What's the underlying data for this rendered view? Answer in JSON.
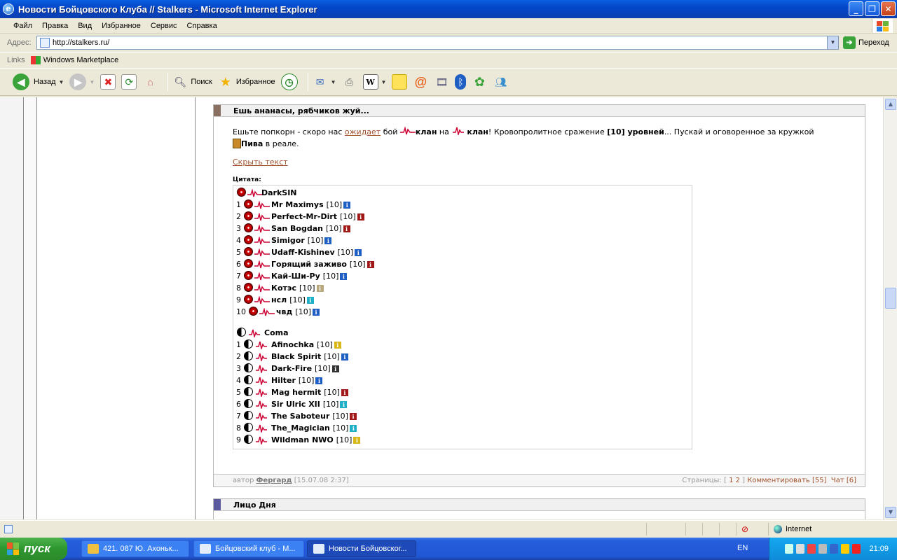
{
  "window": {
    "title": "Новости Бойцовского Клуба // Stalkers - Microsoft Internet Explorer"
  },
  "menu": [
    "Файл",
    "Правка",
    "Вид",
    "Избранное",
    "Сервис",
    "Справка"
  ],
  "address": {
    "label": "Адрес:",
    "url": "http://stalkers.ru/",
    "go": "Переход"
  },
  "links": {
    "label": "Links",
    "item": "Windows Marketplace"
  },
  "toolbar": {
    "back": "Назад",
    "search": "Поиск",
    "favorites": "Избранное"
  },
  "article": {
    "title": "Ешь ананасы, рябчиков жуй...",
    "text_1": "Ешьте попкорн - скоро нас ",
    "link_waits": "ожидает",
    "text_2": " бой ",
    "clan_word": "клан",
    "text_on": " на ",
    "text_3": "! Кровопролитное сражение ",
    "levels": "[10] уровней",
    "text_4": "... Пускай и оговоренное за кружкой ",
    "beer": "Пива",
    "text_5": " в реале.",
    "hide_link": "Скрыть текст",
    "quote_label": "Цитата:",
    "team1": {
      "name": "DarkSIN",
      "members": [
        {
          "n": "1",
          "name": "Mr Maximys",
          "lvl": "[10]",
          "info": "#1f5fc4"
        },
        {
          "n": "2",
          "name": "Perfect-Mr-Dirt",
          "lvl": "[10]",
          "info": "#a01818"
        },
        {
          "n": "3",
          "name": "San Bogdan",
          "lvl": "[10]",
          "info": "#a01818"
        },
        {
          "n": "4",
          "name": "Simigor",
          "lvl": "[10]",
          "info": "#1f5fc4"
        },
        {
          "n": "5",
          "name": "Udaff-Kishinev",
          "lvl": "[10]",
          "info": "#1f5fc4"
        },
        {
          "n": "6",
          "name": "Горящий заживо",
          "lvl": "[10]",
          "info": "#a01818"
        },
        {
          "n": "7",
          "name": "Кай-Ши-Ру",
          "lvl": "[10]",
          "info": "#1f5fc4"
        },
        {
          "n": "8",
          "name": "Котэс",
          "lvl": "[10]",
          "info": "#b8a77a"
        },
        {
          "n": "9",
          "name": "нсл",
          "lvl": "[10]",
          "info": "#1fb0c8"
        },
        {
          "n": "10",
          "name": "чвд",
          "lvl": "[10]",
          "info": "#1f5fc4"
        }
      ]
    },
    "team2": {
      "name": "Coma",
      "members": [
        {
          "n": "1",
          "name": "Afinochka",
          "lvl": "[10]",
          "info": "#d8b818"
        },
        {
          "n": "2",
          "name": "Black Spirit",
          "lvl": "[10]",
          "info": "#1f5fc4"
        },
        {
          "n": "3",
          "name": "Dark-Fire",
          "lvl": "[10]",
          "info": "#333333"
        },
        {
          "n": "4",
          "name": "Hilter",
          "lvl": "[10]",
          "info": "#1f5fc4"
        },
        {
          "n": "5",
          "name": "Mag hermit",
          "lvl": "[10]",
          "info": "#a01818"
        },
        {
          "n": "6",
          "name": "Sir Ulric XII",
          "lvl": "[10]",
          "info": "#1fb0c8"
        },
        {
          "n": "7",
          "name": "The Saboteur",
          "lvl": "[10]",
          "info": "#a01818"
        },
        {
          "n": "8",
          "name": "The_Magician",
          "lvl": "[10]",
          "info": "#1fb0c8"
        },
        {
          "n": "9",
          "name": "Wildman NWO",
          "lvl": "[10]",
          "info": "#d8b818"
        }
      ]
    },
    "footer": {
      "author_label": "автор",
      "author": "Фергард",
      "date": "[15.07.08 2:37]",
      "pages_label": "Страницы: [",
      "pages": "1 2",
      "pages_end": "]",
      "comment": "Комментировать [55]",
      "chat": "Чат [6]"
    }
  },
  "article2": {
    "title": "Лицо Дня"
  },
  "status": {
    "zone": "Internet"
  },
  "taskbar": {
    "start": "пуск",
    "tasks": [
      "421. 087 Ю. Ахоньк...",
      "Бойцовский клуб - М...",
      "Новости Бойцовског..."
    ],
    "lang": "EN",
    "clock": "21:09"
  }
}
